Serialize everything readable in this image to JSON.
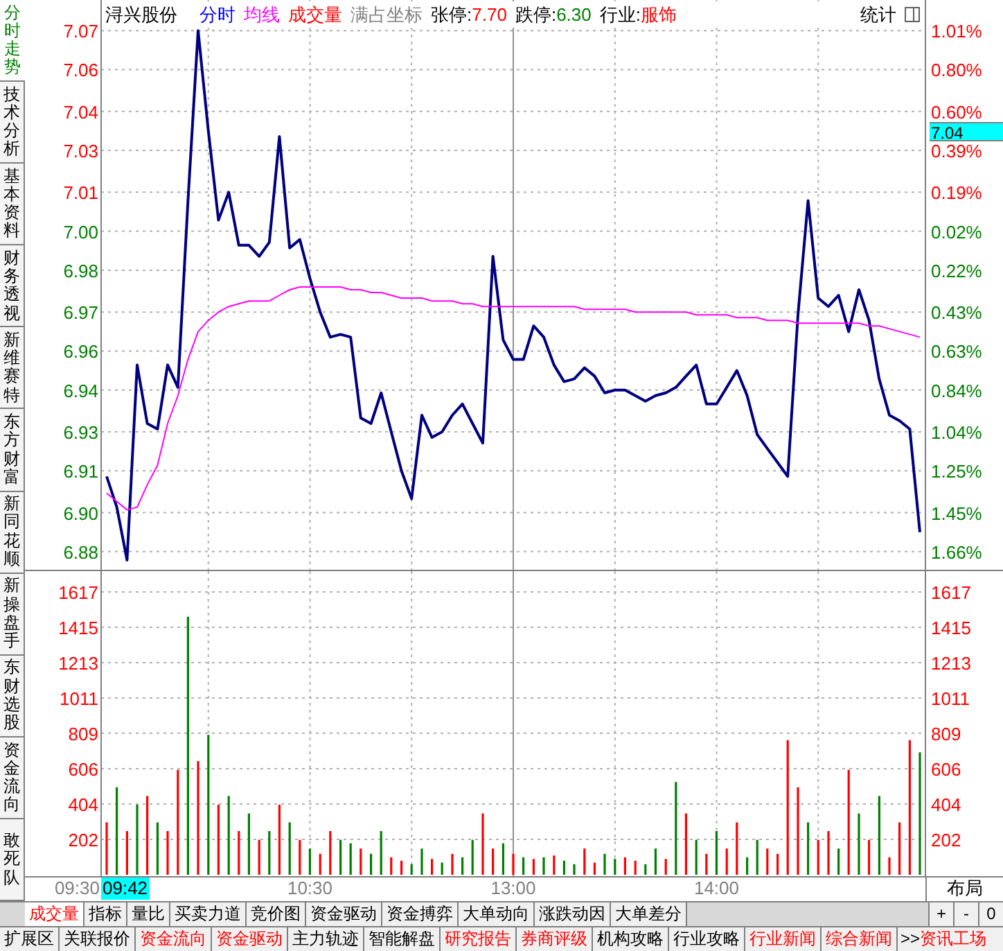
{
  "side_tabs": [
    {
      "label": "分时走势",
      "selected": true
    },
    {
      "label": "技术分析",
      "selected": false
    },
    {
      "label": "基本资料",
      "selected": false
    },
    {
      "label": "财务透视",
      "selected": false
    },
    {
      "label": "新维赛特",
      "selected": false
    },
    {
      "label": "东方财富",
      "selected": false
    },
    {
      "label": "新同花顺",
      "selected": false
    },
    {
      "label": "新操盘手",
      "selected": false
    },
    {
      "label": "东财选股",
      "selected": false
    },
    {
      "label": "资金流向",
      "selected": false
    },
    {
      "label": "敢死队",
      "selected": false
    }
  ],
  "header": {
    "stock_name": "浔兴股份",
    "volume_legend": "成交量",
    "coord_mode": "满占坐标",
    "limit_up": {
      "label": "张停:",
      "value": "7.70"
    },
    "limit_down": {
      "label": "跌停:",
      "value": "6.30"
    },
    "industry": {
      "label": "行业:",
      "value": "服饰"
    },
    "stats": "统计"
  },
  "price_chart": {
    "chart_data": {
      "type": "line",
      "grid": true,
      "ylim": [
        6.877,
        7.082
      ],
      "yticks": [
        {
          "value": 7.071,
          "label": "7.07"
        },
        {
          "value": 7.057,
          "label": "7.06"
        },
        {
          "value": 7.042,
          "label": "7.04"
        },
        {
          "value": 7.028,
          "label": "7.03"
        },
        {
          "value": 7.013,
          "label": "7.01"
        },
        {
          "value": 6.999,
          "label": "7.00"
        },
        {
          "value": 6.985,
          "label": "6.98"
        },
        {
          "value": 6.97,
          "label": "6.97"
        },
        {
          "value": 6.956,
          "label": "6.96"
        },
        {
          "value": 6.942,
          "label": "6.94"
        },
        {
          "value": 6.927,
          "label": "6.93"
        },
        {
          "value": 6.913,
          "label": "6.91"
        },
        {
          "value": 6.898,
          "label": "6.90"
        },
        {
          "value": 6.884,
          "label": "6.88"
        }
      ],
      "categories": [
        null,
        null,
        null,
        null,
        null,
        null,
        null,
        null,
        null,
        null,
        null,
        null,
        null,
        null,
        null,
        null,
        null,
        null,
        null,
        null,
        null,
        null,
        null,
        null,
        null,
        null,
        null,
        null,
        null,
        null,
        null,
        null,
        null,
        null,
        null,
        null,
        null,
        null,
        null,
        null,
        null,
        null,
        null,
        null,
        null,
        null,
        null,
        null,
        null,
        null,
        null,
        null,
        null,
        null,
        null,
        null,
        null,
        null,
        null,
        null,
        null,
        null,
        null,
        null,
        null,
        null,
        null,
        null,
        null,
        null,
        null,
        null,
        null,
        null,
        null,
        null,
        null,
        null,
        null,
        null,
        null
      ],
      "series": [
        {
          "name": "分时",
          "color": "#000080",
          "values": [
            6.911,
            6.9,
            6.881,
            6.951,
            6.93,
            6.928,
            6.951,
            6.943,
            7.01,
            7.071,
            7.035,
            7.003,
            7.013,
            6.994,
            6.994,
            6.99,
            6.995,
            7.033,
            6.993,
            6.996,
            6.982,
            6.97,
            6.961,
            6.962,
            6.961,
            6.932,
            6.93,
            6.941,
            6.927,
            6.913,
            6.903,
            6.933,
            6.925,
            6.927,
            6.933,
            6.937,
            6.93,
            6.923,
            6.99,
            6.96,
            6.953,
            6.953,
            6.965,
            6.961,
            6.951,
            6.945,
            6.946,
            6.95,
            6.947,
            6.941,
            6.942,
            6.942,
            6.94,
            6.938,
            6.94,
            6.941,
            6.943,
            6.947,
            6.951,
            6.937,
            6.937,
            6.943,
            6.949,
            6.94,
            6.926,
            6.921,
            6.916,
            6.911,
            6.969,
            7.01,
            6.975,
            6.972,
            6.976,
            6.963,
            6.978,
            6.967,
            6.946,
            6.933,
            6.931,
            6.928,
            6.891
          ]
        },
        {
          "name": "均线",
          "color": "#ff00ff",
          "values": [
            6.905,
            6.902,
            6.899,
            6.9,
            6.908,
            6.915,
            6.93,
            6.94,
            6.953,
            6.963,
            6.967,
            6.97,
            6.972,
            6.973,
            6.974,
            6.974,
            6.974,
            6.976,
            6.978,
            6.979,
            6.979,
            6.979,
            6.979,
            6.979,
            6.978,
            6.978,
            6.977,
            6.977,
            6.976,
            6.975,
            6.975,
            6.975,
            6.974,
            6.974,
            6.974,
            6.973,
            6.973,
            6.972,
            6.972,
            6.972,
            6.972,
            6.972,
            6.972,
            6.972,
            6.972,
            6.972,
            6.972,
            6.971,
            6.971,
            6.971,
            6.971,
            6.971,
            6.97,
            6.97,
            6.97,
            6.97,
            6.97,
            6.97,
            6.969,
            6.969,
            6.969,
            6.969,
            6.968,
            6.968,
            6.968,
            6.967,
            6.967,
            6.967,
            6.966,
            6.966,
            6.966,
            6.966,
            6.966,
            6.966,
            6.966,
            6.965,
            6.965,
            6.964,
            6.963,
            6.962,
            6.961
          ]
        }
      ]
    },
    "percent_axis": [
      {
        "label": "1.01%",
        "color": "#ff0000"
      },
      {
        "label": "0.80%",
        "color": "#ff0000"
      },
      {
        "label": "0.60%",
        "color": "#ff0000"
      },
      {
        "label": "0.39%",
        "color": "#ff0000"
      },
      {
        "label": "0.19%",
        "color": "#ff0000"
      },
      {
        "label": "0.02%",
        "color": "#008000"
      },
      {
        "label": "0.22%",
        "color": "#008000"
      },
      {
        "label": "0.43%",
        "color": "#008000"
      },
      {
        "label": "0.63%",
        "color": "#008000"
      },
      {
        "label": "0.84%",
        "color": "#008000"
      },
      {
        "label": "1.04%",
        "color": "#008000"
      },
      {
        "label": "1.25%",
        "color": "#008000"
      },
      {
        "label": "1.45%",
        "color": "#008000"
      },
      {
        "label": "1.66%",
        "color": "#008000"
      }
    ],
    "cursor_price": "7.04"
  },
  "volume_chart": {
    "chart_data": {
      "type": "bar",
      "stacked": true,
      "grid": true,
      "ylim": [
        0,
        1617
      ],
      "yticks": [
        {
          "value": 1617,
          "label": "1617"
        },
        {
          "value": 1415,
          "label": "1415"
        },
        {
          "value": 1213,
          "label": "1213"
        },
        {
          "value": 1011,
          "label": "1011"
        },
        {
          "value": 809,
          "label": "809"
        },
        {
          "value": 606,
          "label": "606"
        },
        {
          "value": 404,
          "label": "404"
        },
        {
          "value": 202,
          "label": "202"
        }
      ],
      "categories": [
        null,
        null,
        null,
        null,
        null,
        null,
        null,
        null,
        null,
        null,
        null,
        null,
        null,
        null,
        null,
        null,
        null,
        null,
        null,
        null,
        "10:30",
        null,
        null,
        null,
        null,
        null,
        null,
        null,
        null,
        null,
        null,
        null,
        null,
        null,
        null,
        null,
        null,
        null,
        null,
        null,
        "13:00",
        null,
        null,
        null,
        null,
        null,
        null,
        null,
        null,
        null,
        null,
        null,
        null,
        null,
        null,
        null,
        null,
        null,
        null,
        null,
        "14:00",
        null,
        null,
        null,
        null,
        null,
        null,
        null,
        null,
        null,
        null,
        null,
        null,
        null,
        null,
        null,
        null,
        null,
        null,
        null,
        null
      ],
      "series": [
        {
          "color": "#ff0000",
          "values": [
            300,
            0,
            250,
            0,
            450,
            0,
            250,
            600,
            0,
            650,
            0,
            400,
            0,
            250,
            0,
            200,
            0,
            400,
            0,
            200,
            0,
            120,
            250,
            0,
            0,
            150,
            0,
            0,
            100,
            80,
            0,
            0,
            90,
            0,
            120,
            0,
            0,
            350,
            150,
            0,
            120,
            0,
            90,
            0,
            110,
            0,
            0,
            150,
            70,
            0,
            0,
            100,
            80,
            0,
            0,
            90,
            0,
            350,
            0,
            120,
            0,
            150,
            300,
            0,
            0,
            150,
            120,
            770,
            500,
            0,
            200,
            250,
            0,
            600,
            0,
            200,
            0,
            100,
            300,
            770,
            0
          ]
        },
        {
          "color": "#008000",
          "values": [
            0,
            500,
            0,
            400,
            0,
            300,
            0,
            0,
            1475,
            0,
            800,
            0,
            450,
            0,
            350,
            0,
            250,
            0,
            300,
            0,
            150,
            0,
            0,
            200,
            180,
            0,
            120,
            250,
            0,
            0,
            60,
            150,
            0,
            70,
            0,
            100,
            200,
            0,
            0,
            180,
            0,
            100,
            0,
            100,
            0,
            80,
            60,
            0,
            0,
            120,
            90,
            0,
            0,
            60,
            150,
            0,
            530,
            0,
            200,
            0,
            250,
            0,
            0,
            100,
            200,
            0,
            0,
            0,
            0,
            300,
            0,
            0,
            150,
            0,
            350,
            0,
            450,
            0,
            0,
            0,
            700
          ]
        }
      ]
    },
    "right_axis": [
      "1617",
      "1415",
      "1213",
      "1011",
      "809",
      "606",
      "404",
      "202"
    ]
  },
  "time_axis": {
    "start": "09:30",
    "cursor": "09:42",
    "layout_button": "布局"
  },
  "indicator_tabs": [
    {
      "label": "成交量",
      "selected": true
    },
    {
      "label": "指标",
      "selected": false
    },
    {
      "label": "量比",
      "selected": false
    },
    {
      "label": "买卖力道",
      "selected": false
    },
    {
      "label": "竞价图",
      "selected": false
    },
    {
      "label": "资金驱动",
      "selected": false
    },
    {
      "label": "资金搏弈",
      "selected": false
    },
    {
      "label": "大单动向",
      "selected": false
    },
    {
      "label": "涨跌动因",
      "selected": false
    },
    {
      "label": "大单差分",
      "selected": false
    }
  ],
  "zoom_buttons": [
    "+",
    "-",
    "0"
  ],
  "bottom_tabs": [
    {
      "label": "扩展区",
      "color": "#000000"
    },
    {
      "label": "关联报价",
      "color": "#000000"
    },
    {
      "label": "资金流向",
      "color": "#ff0000"
    },
    {
      "label": "资金驱动",
      "color": "#ff0000"
    },
    {
      "label": "主力轨迹",
      "color": "#000000"
    },
    {
      "label": "智能解盘",
      "color": "#000000"
    },
    {
      "label": "研究报告",
      "color": "#ff0000"
    },
    {
      "label": "券商评级",
      "color": "#ff0000"
    },
    {
      "label": "机构攻略",
      "color": "#000000"
    },
    {
      "label": "行业攻略",
      "color": "#000000"
    },
    {
      "label": "行业新闻",
      "color": "#ff0000"
    },
    {
      "label": "综合新闻",
      "color": "#ff0000"
    }
  ],
  "more_link": {
    "arrow": ">>",
    "label": "资讯工场"
  }
}
